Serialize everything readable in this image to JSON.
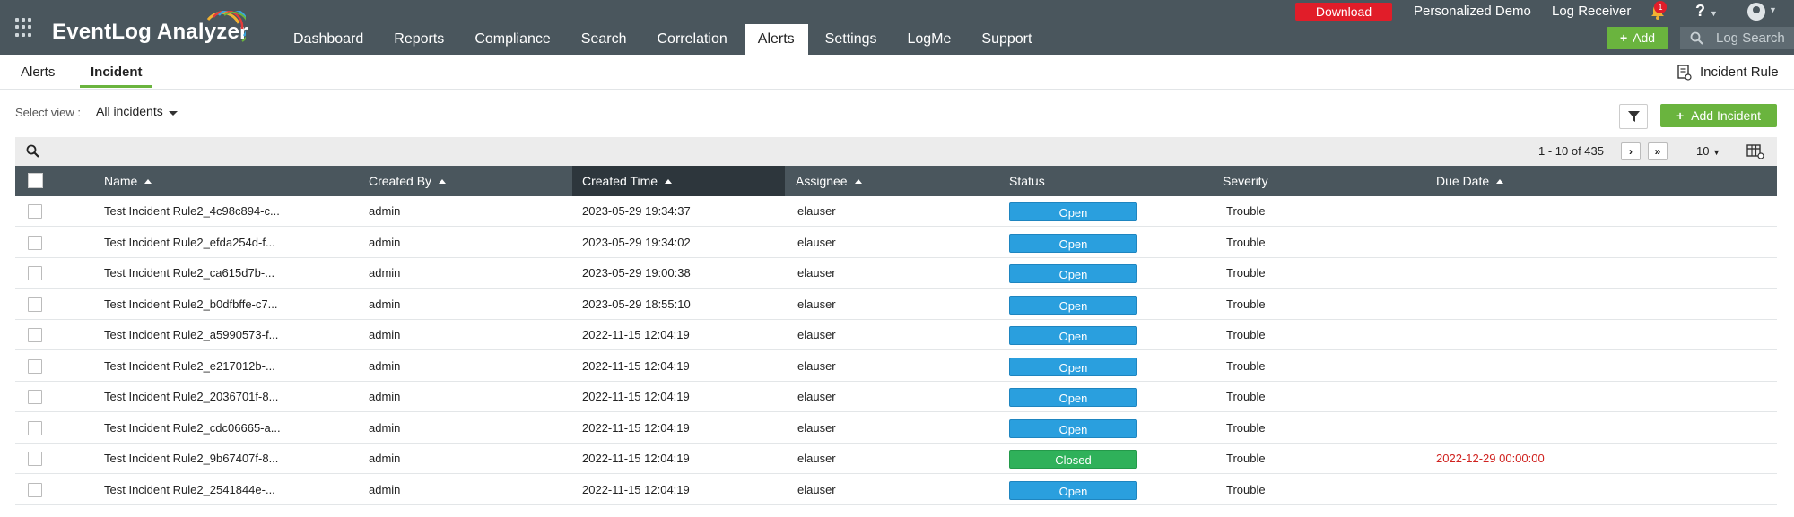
{
  "app": {
    "logo_text": "EventLog Analyzer",
    "nav": [
      "Dashboard",
      "Reports",
      "Compliance",
      "Search",
      "Correlation",
      "Alerts",
      "Settings",
      "LogMe",
      "Support"
    ],
    "active_nav": "Alerts",
    "download_label": "Download",
    "personalized_demo": "Personalized Demo",
    "log_receiver": "Log Receiver",
    "notification_count": "1",
    "help_label": "?",
    "add_label": "Add",
    "log_search_placeholder": "Log Search"
  },
  "subtabs": {
    "alerts": "Alerts",
    "incident": "Incident",
    "incident_rule": "Incident Rule"
  },
  "view": {
    "label": "Select view :",
    "value": "All incidents",
    "add_incident": "Add Incident"
  },
  "pager": {
    "range_text": "1 - 10 of 435",
    "next": "›",
    "last": "»",
    "per_page": "10"
  },
  "table": {
    "columns": [
      "Name",
      "Created By",
      "Created Time",
      "Assignee",
      "Status",
      "Severity",
      "Due Date"
    ],
    "rows": [
      {
        "name": "Test Incident Rule2_4c98c894-c...",
        "created_by": "admin",
        "created_time": "2023-05-29 19:34:37",
        "assignee": "elauser",
        "status": "Open",
        "severity": "Trouble",
        "due_date": ""
      },
      {
        "name": "Test Incident Rule2_efda254d-f...",
        "created_by": "admin",
        "created_time": "2023-05-29 19:34:02",
        "assignee": "elauser",
        "status": "Open",
        "severity": "Trouble",
        "due_date": ""
      },
      {
        "name": "Test Incident Rule2_ca615d7b-...",
        "created_by": "admin",
        "created_time": "2023-05-29 19:00:38",
        "assignee": "elauser",
        "status": "Open",
        "severity": "Trouble",
        "due_date": ""
      },
      {
        "name": "Test Incident Rule2_b0dfbffe-c7...",
        "created_by": "admin",
        "created_time": "2023-05-29 18:55:10",
        "assignee": "elauser",
        "status": "Open",
        "severity": "Trouble",
        "due_date": ""
      },
      {
        "name": "Test Incident Rule2_a5990573-f...",
        "created_by": "admin",
        "created_time": "2022-11-15 12:04:19",
        "assignee": "elauser",
        "status": "Open",
        "severity": "Trouble",
        "due_date": ""
      },
      {
        "name": "Test Incident Rule2_e217012b-...",
        "created_by": "admin",
        "created_time": "2022-11-15 12:04:19",
        "assignee": "elauser",
        "status": "Open",
        "severity": "Trouble",
        "due_date": ""
      },
      {
        "name": "Test Incident Rule2_2036701f-8...",
        "created_by": "admin",
        "created_time": "2022-11-15 12:04:19",
        "assignee": "elauser",
        "status": "Open",
        "severity": "Trouble",
        "due_date": ""
      },
      {
        "name": "Test Incident Rule2_cdc06665-a...",
        "created_by": "admin",
        "created_time": "2022-11-15 12:04:19",
        "assignee": "elauser",
        "status": "Open",
        "severity": "Trouble",
        "due_date": ""
      },
      {
        "name": "Test Incident Rule2_9b67407f-8...",
        "created_by": "admin",
        "created_time": "2022-11-15 12:04:19",
        "assignee": "elauser",
        "status": "Closed",
        "severity": "Trouble",
        "due_date": "2022-12-29 00:00:00"
      },
      {
        "name": "Test Incident Rule2_2541844e-...",
        "created_by": "admin",
        "created_time": "2022-11-15 12:04:19",
        "assignee": "elauser",
        "status": "Open",
        "severity": "Trouble",
        "due_date": ""
      }
    ]
  },
  "colors": {
    "topbar": "#4a565d",
    "accent_green": "#6ab43e",
    "download_red": "#e11d29",
    "status_open": "#2a9fde",
    "status_closed": "#2fb15a",
    "due_overdue": "#d0221f"
  }
}
